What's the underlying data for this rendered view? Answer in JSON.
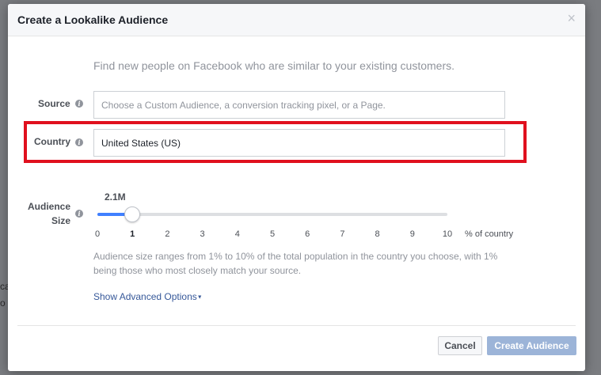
{
  "dialog": {
    "title": "Create a Lookalike Audience",
    "close_glyph": "×",
    "intro": "Find new people on Facebook who are similar to your existing customers."
  },
  "source": {
    "label": "Source",
    "placeholder": "Choose a Custom Audience, a conversion tracking pixel, or a Page."
  },
  "country": {
    "label": "Country",
    "value": "United States (US)"
  },
  "audience_size": {
    "label_line1": "Audience",
    "label_line2": "Size",
    "estimate": "2.1M",
    "selected_percent": 1,
    "ticks": [
      "0",
      "1",
      "2",
      "3",
      "4",
      "5",
      "6",
      "7",
      "8",
      "9",
      "10"
    ],
    "unit": "% of country",
    "help": "Audience size ranges from 1% to 10% of the total population in the country you choose, with 1% being those who most closely match your source."
  },
  "advanced_link": "Show Advanced Options",
  "footer": {
    "cancel": "Cancel",
    "create": "Create Audience"
  },
  "colors": {
    "accent": "#4080ff",
    "highlight": "#e0101e",
    "disabled_primary": "#9cb4d8",
    "link": "#365899"
  }
}
